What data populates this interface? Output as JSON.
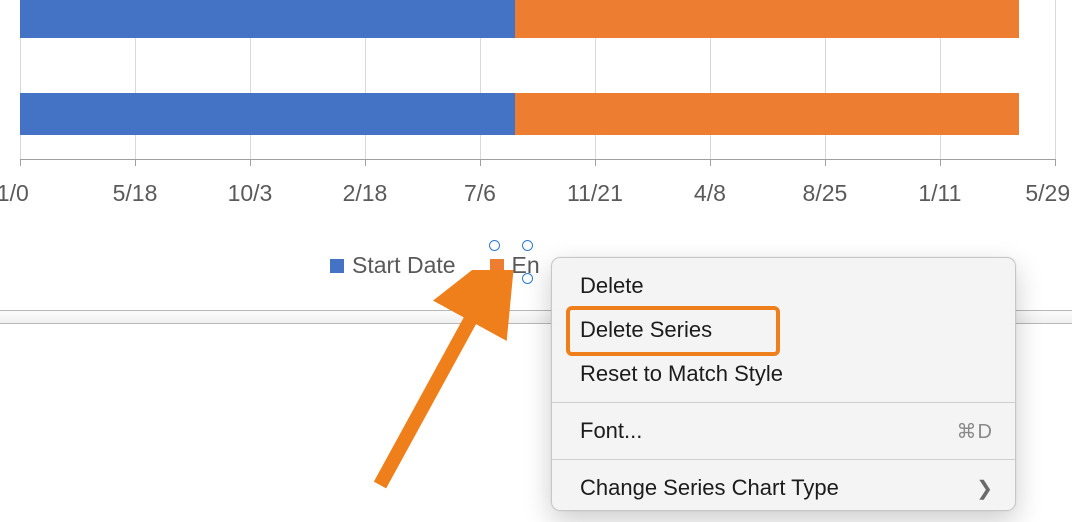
{
  "colors": {
    "blue": "#4472c4",
    "orange": "#ed7d31",
    "highlight": "#ef7f1a"
  },
  "chart_data": {
    "type": "bar",
    "orientation": "horizontal",
    "stacked": true,
    "x_ticks": [
      "1/0",
      "5/18",
      "10/3",
      "2/18",
      "7/6",
      "11/21",
      "4/8",
      "8/25",
      "1/11",
      "5/29"
    ],
    "series": [
      {
        "name": "Start Date",
        "color": "#4472c4",
        "values_fraction": [
          0.478,
          0.478
        ]
      },
      {
        "name": "End Date",
        "color": "#ed7d31",
        "values_fraction": [
          0.487,
          0.487
        ]
      }
    ],
    "legend": [
      "Start Date",
      "End Date"
    ]
  },
  "legend": {
    "items": [
      {
        "label": "Start Date",
        "swatch": "blue"
      },
      {
        "label": "End Date",
        "swatch": "orange",
        "truncated": "En",
        "selected": true
      }
    ]
  },
  "context_menu": {
    "items": [
      {
        "label": "Delete"
      },
      {
        "label": "Delete Series",
        "highlighted": true
      },
      {
        "label": "Reset to Match Style"
      },
      {
        "separator": true
      },
      {
        "label": "Font...",
        "shortcut": "⌘D"
      },
      {
        "separator": true
      },
      {
        "label": "Change Series Chart Type",
        "submenu": true
      }
    ]
  }
}
